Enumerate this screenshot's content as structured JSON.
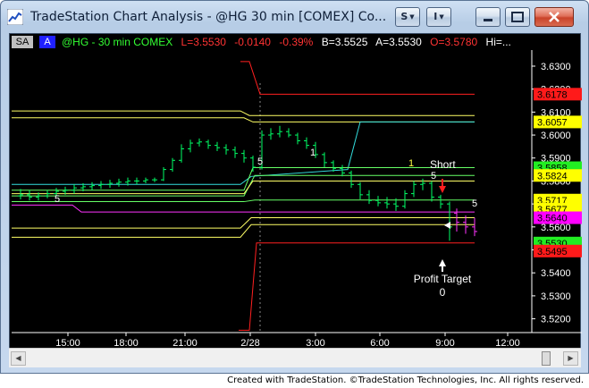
{
  "window": {
    "title": "TradeStation Chart Analysis - @HG 30 min [COMEX] Co...",
    "style_button": "S",
    "insert_button": "I"
  },
  "info_bar": {
    "sa": "SA",
    "a": "A",
    "symbol": "@HG - 30 min COMEX",
    "last": "L=3.5530",
    "change": "-0.0140",
    "change_pct": "-0.39%",
    "bid": "B=3.5525",
    "ask": "A=3.5530",
    "open": "O=3.5780",
    "high": "Hi=..."
  },
  "chart_data": {
    "type": "candlestick",
    "x_tick_labels": [
      "15:00",
      "18:00",
      "21:00",
      "2/28",
      "3:00",
      "6:00",
      "9:00",
      "12:00"
    ],
    "y_tick_labels": [
      "3.6300",
      "3.6200",
      "3.6100",
      "3.6000",
      "3.5900",
      "3.5800",
      "3.5700",
      "3.5600",
      "3.5500",
      "3.5400",
      "3.5300",
      "3.5200"
    ],
    "ylim": [
      3.514,
      3.637
    ],
    "price_tags": [
      {
        "value": 3.6178,
        "label": "3.6178",
        "bg": "#ff1a1a",
        "fg": "#000000"
      },
      {
        "value": 3.6057,
        "label": "3.6057",
        "bg": "#ffff00",
        "fg": "#000000"
      },
      {
        "value": 3.5858,
        "label": "3.5858",
        "bg": "#22ee22",
        "fg": "#000000"
      },
      {
        "value": 3.5824,
        "label": "3.5824",
        "bg": "#ffff00",
        "fg": "#000000"
      },
      {
        "value": 3.5717,
        "label": "3.5717",
        "bg": "#ffff00",
        "fg": "#000000"
      },
      {
        "value": 3.5677,
        "label": "3.5677",
        "bg": "#ffff00",
        "fg": "#000000"
      },
      {
        "value": 3.564,
        "label": "3.5640",
        "bg": "#ff00ff",
        "fg": "#000000"
      },
      {
        "value": 3.553,
        "label": "3.5530",
        "bg": "#22ee22",
        "fg": "#000000"
      },
      {
        "value": 3.5495,
        "label": "3.5495",
        "bg": "#ff1a1a",
        "fg": "#000000"
      }
    ],
    "annotations": {
      "short": "Short",
      "short_number": "5",
      "profit_target": "Profit Target",
      "profit_target_number": "0",
      "label_5_left": "5",
      "label_5_mid": "5",
      "label_5_right": "5",
      "label_1_mid": "1",
      "label_1_right": "1"
    },
    "colors": {
      "red": "#ff2020",
      "yellow": "#ffff66",
      "green": "#66ff66",
      "cyan": "#33dddd",
      "magenta": "#ff33ff",
      "bars": "#00ff66"
    }
  },
  "footer": {
    "text": "Created with TradeStation. ©TradeStation Technologies, Inc. All rights reserved."
  }
}
